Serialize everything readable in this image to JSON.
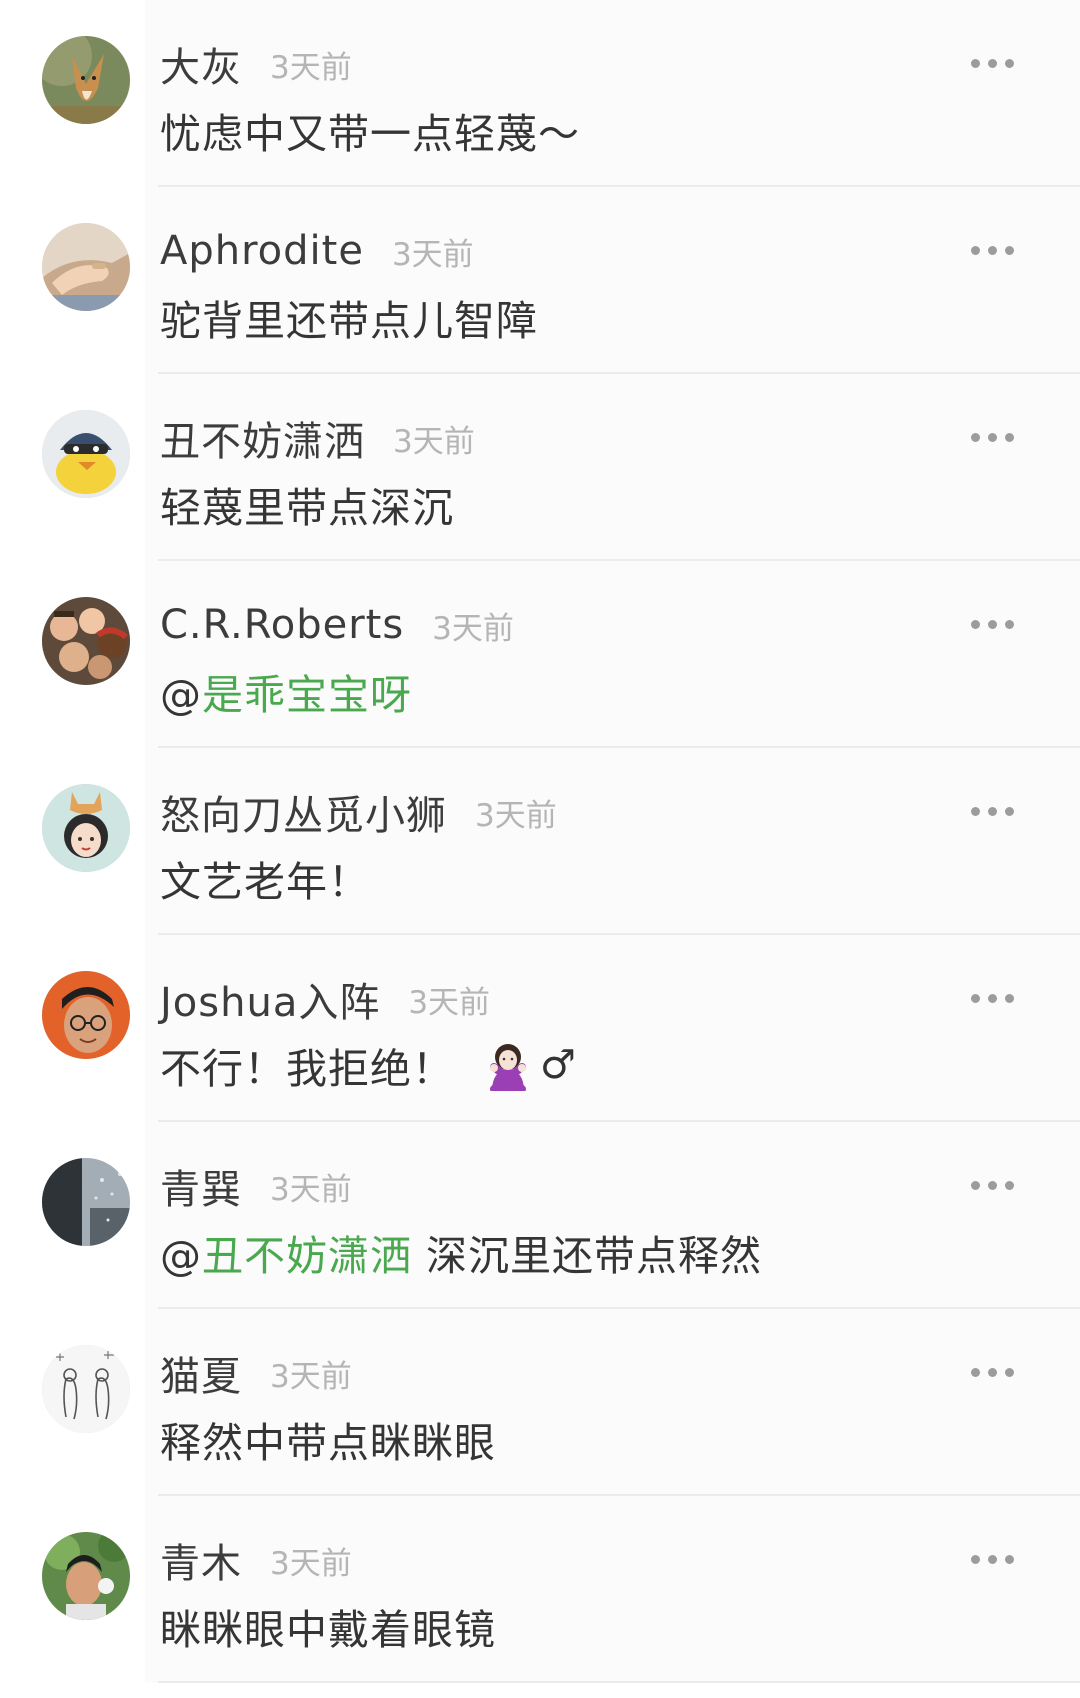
{
  "comments": [
    {
      "username": "大灰",
      "time": "3天前",
      "mention": "",
      "text": "忧虑中又带一点轻蔑～",
      "avatar": "fox-avatar"
    },
    {
      "username": "Aphrodite",
      "time": "3天前",
      "mention": "",
      "text": "驼背里还带点儿智障",
      "avatar": "hand-avatar"
    },
    {
      "username": "丑不妨潇洒",
      "time": "3天前",
      "mention": "",
      "text": "轻蔑里带点深沉",
      "avatar": "cartoon-duck-avatar"
    },
    {
      "username": "C.R.Roberts",
      "time": "3天前",
      "mention": "是乖宝宝呀",
      "text": "",
      "avatar": "group-photo-avatar"
    },
    {
      "username": "怒向刀丛觅小狮",
      "time": "3天前",
      "mention": "",
      "text": "文艺老年！",
      "avatar": "girl-with-dog-avatar"
    },
    {
      "username": "Joshua入阵",
      "time": "3天前",
      "mention": "",
      "text": "不行！我拒绝！",
      "emoji": "woman-gesturing-no",
      "emoji_suffix": "♂",
      "avatar": "man-glasses-avatar"
    },
    {
      "username": "青巽",
      "time": "3天前",
      "mention": "丑不妨潇洒",
      "text": " 深沉里还带点释然",
      "avatar": "rainy-window-avatar"
    },
    {
      "username": "猫夏",
      "time": "3天前",
      "mention": "",
      "text": "释然中带点眯眯眼",
      "avatar": "sketch-drawing-avatar"
    },
    {
      "username": "青木",
      "time": "3天前",
      "mention": "",
      "text": "眯眯眼中戴着眼镜",
      "avatar": "man-outdoor-avatar"
    }
  ],
  "mention_prefix": "@",
  "more_icon": "more-dots-icon",
  "colors": {
    "mention": "#4aa84e",
    "timestamp": "#b5b5b5",
    "username": "#3c3c3c",
    "divider": "#ebebeb"
  }
}
